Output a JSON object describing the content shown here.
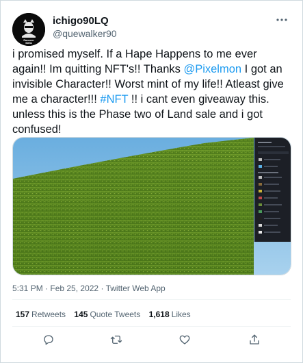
{
  "author": {
    "display_name": "ichigo90LQ",
    "handle": "@quewalker90",
    "avatar_text": [
      "Raccoon",
      "Mafia"
    ]
  },
  "more_icon": "more-horizontal-icon",
  "tweet": {
    "text_1": "i promised myself. If a Hape Happens to me ever again!! Im quitting NFT's!! Thanks ",
    "mention": "@Pixelmon",
    "text_2": " I got an invisible Character!! Worst mint of my life!! Atleast give me a character!!! ",
    "hashtag": "#NFT",
    "text_3": " !! i cant even giveaway this. unless this is the Phase two of Land sale and i got confused!"
  },
  "meta": {
    "time": "5:31 PM",
    "date": "Feb 25, 2022",
    "source": "Twitter Web App",
    "separator": " · "
  },
  "stats": {
    "retweets_count": "157",
    "retweets_label": "Retweets",
    "quotes_count": "145",
    "quotes_label": "Quote Tweets",
    "likes_count": "1,618",
    "likes_label": "Likes"
  },
  "actions": [
    "reply-icon",
    "retweet-icon",
    "like-icon",
    "share-icon"
  ],
  "colors": {
    "link": "#1d9bf0",
    "secondary_text": "#536471",
    "sky": "#77b6e2",
    "grass": "#5b8a1e",
    "panel": "#1c1f26"
  }
}
